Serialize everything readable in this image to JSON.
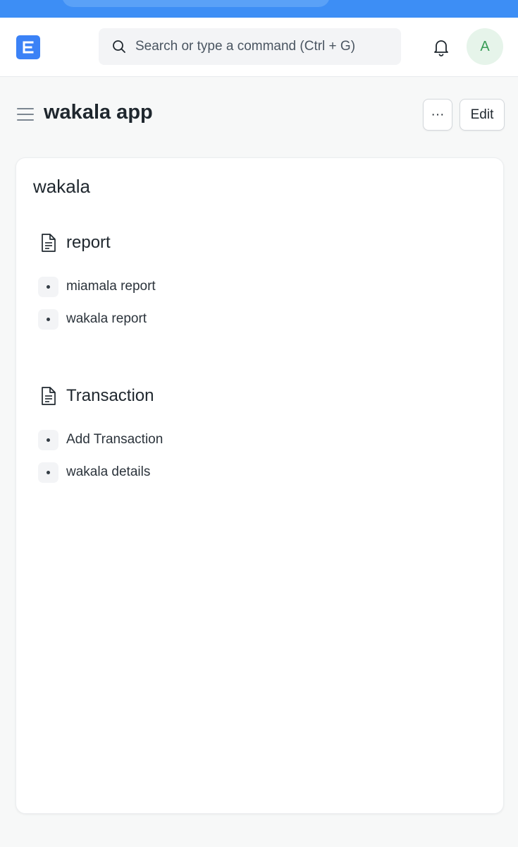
{
  "navbar": {
    "logo_letter": "E",
    "search_placeholder": "Search or type a command (Ctrl + G)",
    "avatar_initial": "A"
  },
  "header": {
    "title": "wakala app",
    "more_label": "···",
    "edit_label": "Edit"
  },
  "card": {
    "title": "wakala",
    "sections": [
      {
        "label": "report",
        "links": [
          "miamala report",
          "wakala report"
        ]
      },
      {
        "label": "Transaction",
        "links": [
          "Add Transaction",
          "wakala details"
        ]
      }
    ]
  },
  "colors": {
    "accent": "#3b82f6",
    "top_strip": "#3d8ef5",
    "avatar_bg": "#e6f4ea",
    "avatar_fg": "#3a9d57"
  }
}
